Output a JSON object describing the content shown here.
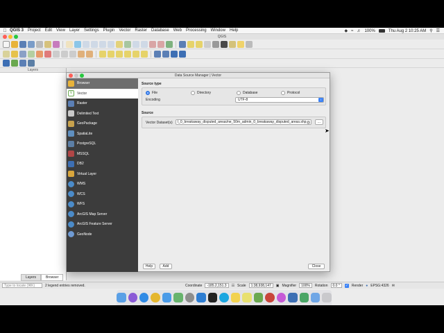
{
  "menubar": {
    "app": "QGIS 3",
    "items": [
      "Project",
      "Edit",
      "View",
      "Layer",
      "Settings",
      "Plugin",
      "Vector",
      "Raster",
      "Database",
      "Web",
      "Processing",
      "Window",
      "Help"
    ],
    "battery": "100%",
    "clock": "Thu Aug 2  10:25 AM"
  },
  "window": {
    "title": "QGIS"
  },
  "layers_panel": {
    "title": "Layers",
    "tabs": [
      "Layers",
      "Browser"
    ]
  },
  "dialog": {
    "title": "Data Source Manager | Vector",
    "sidebar": [
      {
        "label": "Browser",
        "icon": "folder-icon",
        "color": "#e8b33a"
      },
      {
        "label": "Vector",
        "icon": "vector-icon",
        "color": "#6aa84f"
      },
      {
        "label": "Raster",
        "icon": "raster-icon",
        "color": "#5b7fb5"
      },
      {
        "label": "Delimited Text",
        "icon": "delimited-text-icon",
        "color": "#c9c9c9"
      },
      {
        "label": "GeoPackage",
        "icon": "geopackage-icon",
        "color": "#c8a24d"
      },
      {
        "label": "SpatiaLite",
        "icon": "spatialite-icon",
        "color": "#5f8fbf"
      },
      {
        "label": "PostgreSQL",
        "icon": "postgresql-icon",
        "color": "#5c7fa6"
      },
      {
        "label": "MSSQL",
        "icon": "mssql-icon",
        "color": "#b04646"
      },
      {
        "label": "DB2",
        "icon": "db2-icon",
        "color": "#3d6fb4"
      },
      {
        "label": "Virtual Layer",
        "icon": "virtual-layer-icon",
        "color": "#d8a53c"
      },
      {
        "label": "WMS",
        "icon": "wms-icon",
        "color": "#4b8bc9"
      },
      {
        "label": "WCS",
        "icon": "wcs-icon",
        "color": "#4b8bc9"
      },
      {
        "label": "WFS",
        "icon": "wfs-icon",
        "color": "#4b8bc9"
      },
      {
        "label": "ArcGIS Map Server",
        "icon": "arcgis-map-server-icon",
        "color": "#4b8bc9"
      },
      {
        "label": "ArcGIS Feature Server",
        "icon": "arcgis-feature-server-icon",
        "color": "#4b8bc9"
      },
      {
        "label": "GeoNode",
        "icon": "geonode-icon",
        "color": "#6f9ad3"
      }
    ],
    "source_type": {
      "heading": "Source type",
      "options": [
        "File",
        "Directory",
        "Database",
        "Protocol"
      ],
      "selected": "File",
      "encoding_label": "Encoding",
      "encoding_value": "UTF-8"
    },
    "source": {
      "heading": "Source",
      "dataset_label": "Vector Dataset(s)",
      "dataset_value": "l_0_breakaway_disputed_areas/ne_50m_admin_0_breakaway_disputed_areas.shp",
      "browse_label": "..."
    },
    "buttons": {
      "help": "Help",
      "add": "Add",
      "close": "Close"
    }
  },
  "statusbar": {
    "locate_placeholder": "Type to locate (⌘K)",
    "message": "2 legend entries removed.",
    "coordinate_label": "Coordinate",
    "coordinate_value": "-185.2,151.3",
    "scale_label": "Scale",
    "scale_value": "1:38,938,147",
    "magnifier_label": "Magnifier",
    "magnifier_value": "100%",
    "rotation_label": "Rotation",
    "rotation_value": "0.0 °",
    "render_label": "Render",
    "crs": "EPSG:4326"
  }
}
